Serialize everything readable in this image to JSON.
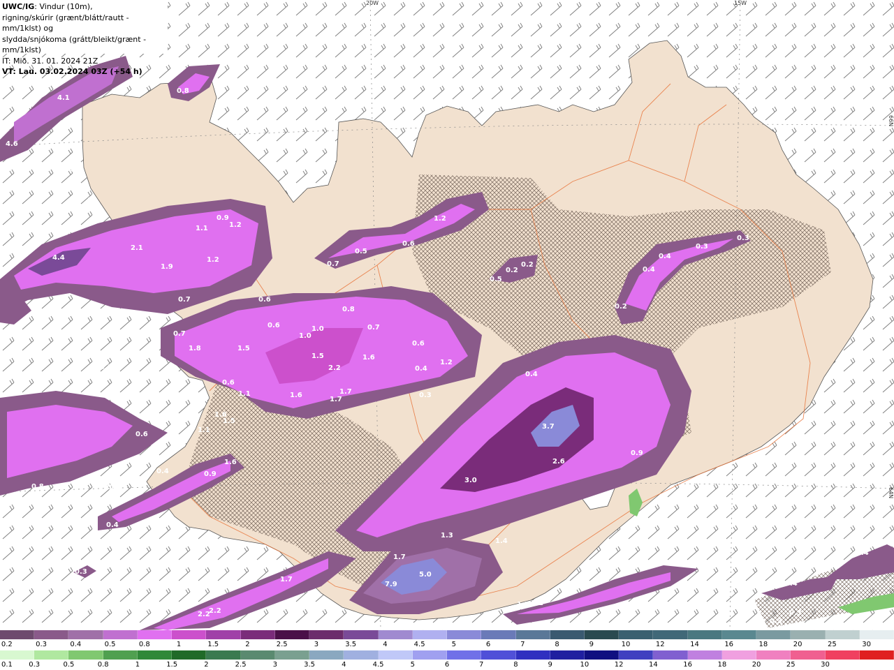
{
  "header": {
    "line1_bold": "UWC/IG",
    "line1_rest": ": Vindur (10m),",
    "line2": "rigning/skúrir (grænt/blátt/rautt - mm/1klst) og",
    "line3": "slydda/snjókoma (grátt/bleikt/grænt - mm/1klst)",
    "line4": "IT: Mið. 31. 01. 2024 21Z",
    "line5": "VT: Lau. 03.02.2024 03Z (+54 h)"
  },
  "gridlabels": {
    "lon20": "20W",
    "lon15": "15W",
    "lat66": "66N",
    "lat64": "64N"
  },
  "legend": {
    "snow_colors": [
      "#6e4a6e",
      "#8a5a8a",
      "#a070a8",
      "#c070d0",
      "#e070f0",
      "#cc50cc",
      "#a040a8",
      "#7a2c7a",
      "#4a1048",
      "#6c2c6c",
      "#7a4a98",
      "#a08ad0",
      "#b0b0f0",
      "#8a8ad8",
      "#6a7ab8",
      "#5a7898",
      "#3a5a70",
      "#2a4a50",
      "#3a6070",
      "#406878",
      "#4a7880",
      "#5a8890",
      "#7a9aa0",
      "#9ab0b0",
      "#c0d0d0",
      "#e6eef0"
    ],
    "snow_labels": [
      "0.2",
      "0.3",
      "0.4",
      "0.5",
      "0.8",
      "1",
      "1.5",
      "2",
      "2.5",
      "3",
      "3.5",
      "4",
      "4.5",
      "5",
      "6",
      "7",
      "8",
      "9",
      "10",
      "12",
      "14",
      "16",
      "18",
      "20",
      "25",
      "30"
    ],
    "rain_colors": [
      "#d8f8d0",
      "#b0e8a0",
      "#80c870",
      "#50a050",
      "#308838",
      "#206a28",
      "#3a7a50",
      "#5a8a70",
      "#7aa090",
      "#8aa8c0",
      "#a0b0e0",
      "#c0c8f8",
      "#a0a0f0",
      "#7070e8",
      "#5050d8",
      "#3030c0",
      "#2020a0",
      "#101080",
      "#4040c0",
      "#8060d0",
      "#c080e0",
      "#f0a0e0",
      "#f080c0",
      "#f06090",
      "#f04060",
      "#e02020"
    ],
    "rain_labels": [
      "0.1",
      "0.3",
      "0.5",
      "0.8",
      "1",
      "1.5",
      "2",
      "2.5",
      "3",
      "3.5",
      "4",
      "4.5",
      "5",
      "6",
      "7",
      "8",
      "9",
      "10",
      "12",
      "14",
      "16",
      "18",
      "20",
      "25",
      "30"
    ]
  },
  "map_values": [
    {
      "t": "4.1"
    },
    {
      "t": "0.8"
    },
    {
      "t": "4.6"
    },
    {
      "t": "0.4"
    },
    {
      "t": "0.4"
    },
    {
      "t": "0.4"
    },
    {
      "t": "0.9"
    },
    {
      "t": "1.2"
    },
    {
      "t": "1.1"
    },
    {
      "t": "4.4"
    },
    {
      "t": "2.1"
    },
    {
      "t": "1.9"
    },
    {
      "t": "1.2"
    },
    {
      "t": "0.7"
    },
    {
      "t": "0.6"
    },
    {
      "t": "0.5"
    },
    {
      "t": "0.6"
    },
    {
      "t": "1.0"
    },
    {
      "t": "1.0"
    },
    {
      "t": "0.7"
    },
    {
      "t": "0.8"
    },
    {
      "t": "0.7"
    },
    {
      "t": "1.8"
    },
    {
      "t": "1.5"
    },
    {
      "t": "1.5"
    },
    {
      "t": "2.2"
    },
    {
      "t": "1.6"
    },
    {
      "t": "0.6"
    },
    {
      "t": "1.2"
    },
    {
      "t": "0.4"
    },
    {
      "t": "0.3"
    },
    {
      "t": "0.3"
    },
    {
      "t": "0.6"
    },
    {
      "t": "1.1"
    },
    {
      "t": "1.6"
    },
    {
      "t": "1.7"
    },
    {
      "t": "1.7"
    },
    {
      "t": "1.6"
    },
    {
      "t": "1.5"
    },
    {
      "t": "1.1"
    },
    {
      "t": "0.6"
    },
    {
      "t": "1.6"
    },
    {
      "t": "0.4"
    },
    {
      "t": "0.9"
    },
    {
      "t": "0.8"
    },
    {
      "t": "0.4"
    },
    {
      "t": "0.7"
    },
    {
      "t": "0.4"
    },
    {
      "t": "0.5"
    },
    {
      "t": "0.6"
    },
    {
      "t": "1.2"
    },
    {
      "t": "0.7"
    },
    {
      "t": "0.5"
    },
    {
      "t": "0.2"
    },
    {
      "t": "0.2"
    },
    {
      "t": "0.3"
    },
    {
      "t": "0.4"
    },
    {
      "t": "0.4"
    },
    {
      "t": "0.3"
    },
    {
      "t": "0.2"
    },
    {
      "t": "0.4"
    },
    {
      "t": "0.3"
    },
    {
      "t": "3.7"
    },
    {
      "t": "2.6"
    },
    {
      "t": "3.0"
    },
    {
      "t": "0.9"
    },
    {
      "t": "1.3"
    },
    {
      "t": "1.4"
    },
    {
      "t": "1.7"
    },
    {
      "t": "7.9"
    },
    {
      "t": "5.0"
    },
    {
      "t": "1.7"
    },
    {
      "t": "2.2"
    },
    {
      "t": "2.2"
    },
    {
      "t": "1.1"
    },
    {
      "t": "1.1"
    },
    {
      "t": "0.3"
    },
    {
      "t": "0.4"
    },
    {
      "t": "0.4"
    },
    {
      "t": "0.3"
    },
    {
      "t": "0.3"
    }
  ]
}
